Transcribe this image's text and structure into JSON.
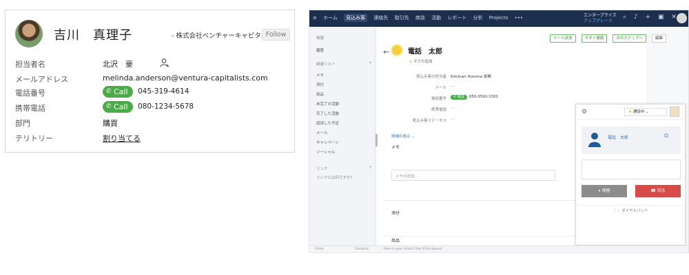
{
  "contact": {
    "name": "吉川　真理子",
    "company": "- 株式会社ベンチャーキャピタル",
    "follow_label": "Follow",
    "fields": {
      "owner_label": "担当者名",
      "owner_value": "北沢　豪",
      "email_label": "メールアドレス",
      "email_value": "melinda.anderson@ventura-capitalists.com",
      "phone_label": "電話番号",
      "phone_value": "045-319-4614",
      "mobile_label": "携帯電話",
      "mobile_value": "080-1234-5678",
      "dept_label": "部門",
      "dept_value": "購買",
      "territory_label": "テリトリー",
      "territory_value": "割り当てる"
    },
    "call_label": "Call",
    "colors": {
      "call_green": "#4aac47"
    }
  },
  "crm": {
    "nav": [
      "ホーム",
      "見込み客",
      "連絡先",
      "取引先",
      "商談",
      "活動",
      "レポート",
      "分析",
      "Projects",
      "•••"
    ],
    "edition": "エンタープライズ",
    "edition_sub": "アップグレード",
    "sidebar": {
      "info_header": "情報",
      "history": "履歴",
      "related_header": "関連リスト",
      "items": [
        "メモ",
        "添付",
        "商品",
        "未完了の活動",
        "完了した活動",
        "招待した予定",
        "メール",
        "キャンペーン",
        "ソーシャル"
      ],
      "links_header": "リンク",
      "links_hint": "リンクとは何ですか?"
    },
    "actions": [
      "メール送信",
      "今すぐ連絡",
      "次のステップへ",
      "編集"
    ],
    "lead_name": "電話　太郎",
    "tag_add": "タグの追加",
    "fields": [
      {
        "k": "見込み客の担当者",
        "v": "Kiminari Homma 本間"
      },
      {
        "k": "メール",
        "v": "—"
      },
      {
        "k": "電話番号",
        "v": "050-3592-1301"
      },
      {
        "k": "携帯電話",
        "v": "—"
      },
      {
        "k": "見込み客ステータス",
        "v": "—"
      }
    ],
    "call_mini": "電話",
    "details_link": "詳細の表示",
    "memo_title": "メモ",
    "memo_placeholder": "メモの追加...",
    "attach_title": "添付",
    "product_title": "商品",
    "widget": {
      "status": "通話中",
      "caller": "電話　太郎",
      "hold": "保留",
      "end": "切る",
      "dialpad": "ダイヤルパッド"
    },
    "bottom": {
      "chat": "Chats",
      "contacts": "Contacts",
      "smart": "Here is your Smart Chat (Ctrl+Space)"
    }
  }
}
